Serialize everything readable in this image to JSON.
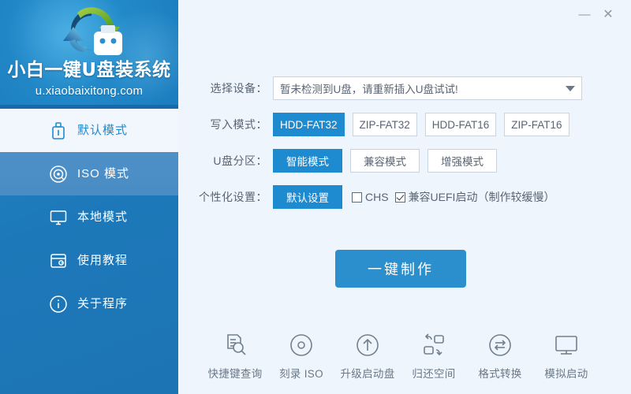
{
  "window": {
    "minimize_label": "—",
    "close_label": "✕"
  },
  "brand": {
    "title": "小白一键U盘装系统",
    "url": "u.xiaobaixitong.com",
    "logo_icon": "refresh-usb-logo"
  },
  "sidebar": {
    "items": [
      {
        "label": "默认模式",
        "icon": "usb-drive-icon",
        "state": "active-white"
      },
      {
        "label": "ISO 模式",
        "icon": "disc-icon",
        "state": "active-light"
      },
      {
        "label": "本地模式",
        "icon": "monitor-icon",
        "state": "normal"
      },
      {
        "label": "使用教程",
        "icon": "wallet-book-icon",
        "state": "normal"
      },
      {
        "label": "关于程序",
        "icon": "info-circle-icon",
        "state": "normal"
      }
    ]
  },
  "form": {
    "device": {
      "label": "选择设备：",
      "value": "暂未检测到U盘，请重新插入U盘试试!",
      "caret_icon": "chevron-down-icon"
    },
    "write_mode": {
      "label": "写入模式：",
      "options": [
        "HDD-FAT32",
        "ZIP-FAT32",
        "HDD-FAT16",
        "ZIP-FAT16"
      ],
      "selected": "HDD-FAT32"
    },
    "partition": {
      "label": "U盘分区：",
      "options": [
        "智能模式",
        "兼容模式",
        "增强模式"
      ],
      "selected": "智能模式"
    },
    "personalize": {
      "label": "个性化设置：",
      "options": [
        "默认设置"
      ],
      "selected": "默认设置",
      "checkboxes": [
        {
          "label": "CHS",
          "checked": false
        },
        {
          "label": "兼容UEFI启动（制作较缓慢）",
          "checked": true
        }
      ]
    }
  },
  "action": {
    "make_label": "一键制作"
  },
  "toolbar": {
    "items": [
      {
        "label": "快捷键查询",
        "icon": "document-search-icon"
      },
      {
        "label": "刻录 ISO",
        "icon": "disc-burn-icon"
      },
      {
        "label": "升级启动盘",
        "icon": "arrow-up-circle-icon"
      },
      {
        "label": "归还空间",
        "icon": "restore-space-icon"
      },
      {
        "label": "格式转换",
        "icon": "convert-arrows-icon"
      },
      {
        "label": "模拟启动",
        "icon": "monitor-boot-icon"
      }
    ]
  },
  "colors": {
    "accent": "#1e8ad0",
    "sidebar_blue": "#1d78b9",
    "background": "#eef5fd",
    "button_blue": "#2a8fcc"
  }
}
